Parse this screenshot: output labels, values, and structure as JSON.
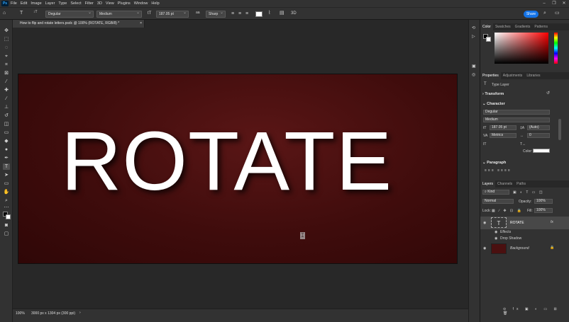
{
  "app": {
    "logo_text": "Ps",
    "window_controls": [
      "–",
      "❐",
      "✕"
    ]
  },
  "menu": [
    "File",
    "Edit",
    "Image",
    "Layer",
    "Type",
    "Select",
    "Filter",
    "3D",
    "View",
    "Plugins",
    "Window",
    "Help"
  ],
  "options_bar": {
    "font_family": "Degular",
    "font_style": "Medium",
    "font_size": "187.05 pt",
    "antialias": "Sharp",
    "three_d": "3D",
    "share": "Share"
  },
  "document": {
    "tab_title": "How to flip and rotate letters.psdc @ 100% (ROTATE, RGB/8) *"
  },
  "canvas": {
    "text": "ROTATE"
  },
  "status": {
    "zoom": "100%",
    "dimensions": "3000 px x 1304 px (300 ppi)"
  },
  "color_panel": {
    "tabs": [
      "Color",
      "Swatches",
      "Gradients",
      "Patterns"
    ]
  },
  "properties_panel": {
    "tabs": [
      "Properties",
      "Adjustments",
      "Libraries"
    ],
    "layer_type": "Type Layer",
    "transform": "Transform",
    "character": "Character",
    "font_family": "Degular",
    "font_style": "Medium",
    "size": "187.05 pt",
    "leading": "(Auto)",
    "kerning": "Metrics",
    "tracking": "0",
    "color_label": "Color:",
    "paragraph": "Paragraph"
  },
  "layers_panel": {
    "tabs": [
      "Layers",
      "Channels",
      "Paths"
    ],
    "kind": "Kind",
    "blend_mode": "Normal",
    "opacity_label": "Opacity:",
    "opacity": "100%",
    "lock_label": "Lock:",
    "fill_label": "Fill:",
    "fill": "100%",
    "layers": [
      {
        "name": "ROTATE",
        "fx": "fx"
      },
      {
        "name": "Effects"
      },
      {
        "name": "Drop Shadow"
      },
      {
        "name": "Background"
      }
    ]
  }
}
